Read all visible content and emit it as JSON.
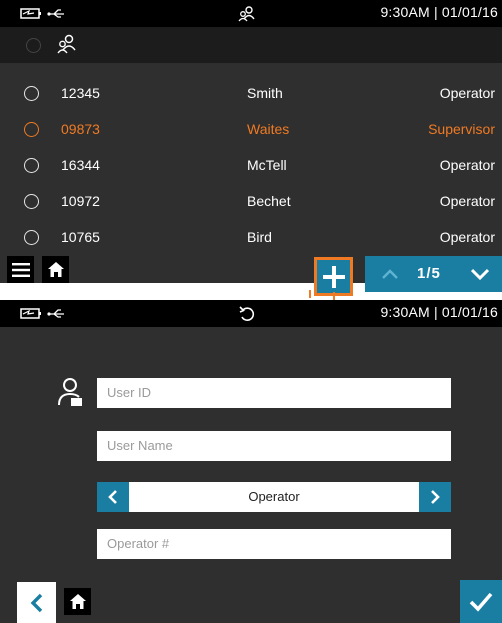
{
  "list_screen": {
    "status": {
      "time": "9:30AM | 01/01/16",
      "center_icon": "users-icon"
    },
    "header_icon": "users-icon",
    "rows": [
      {
        "id": "12345",
        "name": "Smith",
        "role": "Operator",
        "selected": false
      },
      {
        "id": "09873",
        "name": "Waites",
        "role": "Supervisor",
        "selected": true
      },
      {
        "id": "16344",
        "name": "McTell",
        "role": "Operator",
        "selected": false
      },
      {
        "id": "10972",
        "name": "Bechet",
        "role": "Operator",
        "selected": false
      },
      {
        "id": "10765",
        "name": "Bird",
        "role": "Operator",
        "selected": false
      }
    ],
    "pager": {
      "label": "1/5"
    }
  },
  "form_screen": {
    "status": {
      "time": "9:30AM | 01/01/16",
      "center_icon": "undo-icon"
    },
    "fields": {
      "user_id_placeholder": "User ID",
      "user_name_placeholder": "User Name",
      "operator_num_placeholder": "Operator #"
    },
    "role_value": "Operator"
  },
  "colors": {
    "accent": "#f07a23",
    "primary": "#1a7ea3",
    "screen_bg": "#2f2f2f",
    "bar_bg": "#000000"
  }
}
